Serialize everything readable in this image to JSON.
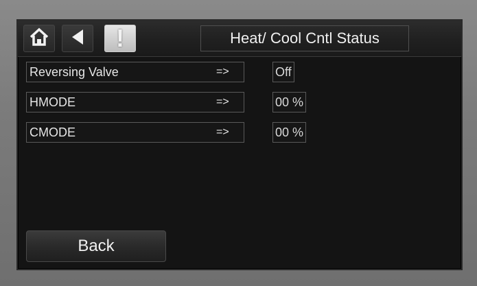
{
  "header": {
    "title": "Heat/ Cool Cntl Status",
    "home_icon": "home-icon",
    "back_icon": "left-arrow-icon",
    "alarm_mark": "!",
    "alarm_icon": "exclamation-icon"
  },
  "rows": [
    {
      "label": "Reversing Valve",
      "arrow": "=>",
      "value": "Off"
    },
    {
      "label": "HMODE",
      "arrow": "=>",
      "value": "00 %"
    },
    {
      "label": "CMODE",
      "arrow": "=>",
      "value": "00 %"
    }
  ],
  "footer": {
    "back_label": "Back"
  }
}
